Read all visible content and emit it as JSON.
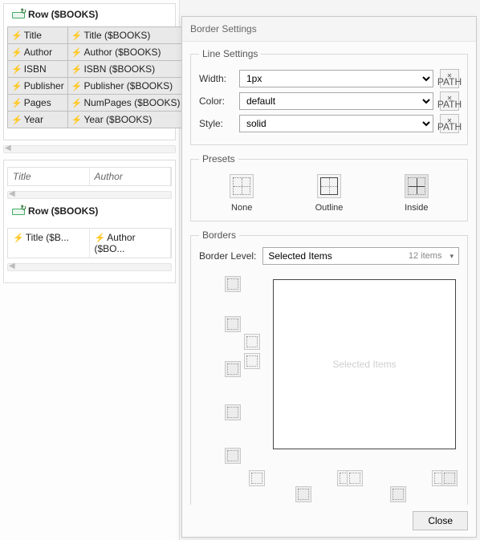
{
  "left": {
    "row_title": "Row ($BOOKS)",
    "properties": [
      {
        "label": "Title",
        "value": "Title ($BOOKS)"
      },
      {
        "label": "Author",
        "value": "Author ($BOOKS)"
      },
      {
        "label": "ISBN",
        "value": "ISBN ($BOOKS)"
      },
      {
        "label": "Publisher",
        "value": "Publisher ($BOOKS)"
      },
      {
        "label": "Pages",
        "value": "NumPages ($BOOKS)"
      },
      {
        "label": "Year",
        "value": "Year ($BOOKS)"
      }
    ],
    "secondary_headers": [
      "Title",
      "Author"
    ],
    "row_title_2": "Row ($BOOKS)",
    "secondary_cells": [
      "Title ($B...",
      "Author ($BO..."
    ]
  },
  "dialog": {
    "title": "Border Settings",
    "line_settings": {
      "legend": "Line Settings",
      "width_label": "Width:",
      "width_value": "1px",
      "color_label": "Color:",
      "color_value": "default",
      "style_label": "Style:",
      "style_value": "solid",
      "xpath_label": "PATH"
    },
    "presets": {
      "legend": "Presets",
      "none": "None",
      "outline": "Outline",
      "inside": "Inside"
    },
    "borders": {
      "legend": "Borders",
      "level_label": "Border Level:",
      "level_value": "Selected Items",
      "count": "12 items",
      "preview_text": "Selected Items"
    },
    "close": "Close"
  }
}
